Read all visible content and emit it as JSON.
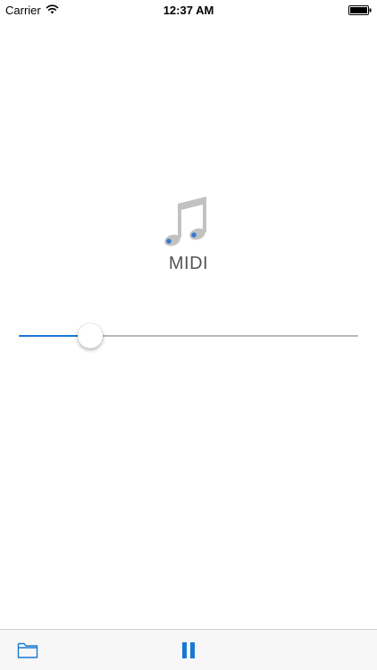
{
  "status_bar": {
    "carrier": "Carrier",
    "time": "12:37 AM",
    "wifi_icon": "wifi-icon",
    "battery_icon": "battery-icon"
  },
  "player": {
    "artwork_icon": "music-note-icon",
    "title": "MIDI",
    "progress": 0.21
  },
  "toolbar": {
    "folder_icon": "folder-icon",
    "pause_icon": "pause-icon"
  },
  "colors": {
    "accent": "#1878d4",
    "track": "#b8b8b8",
    "note_gray": "#c2c2c2"
  }
}
